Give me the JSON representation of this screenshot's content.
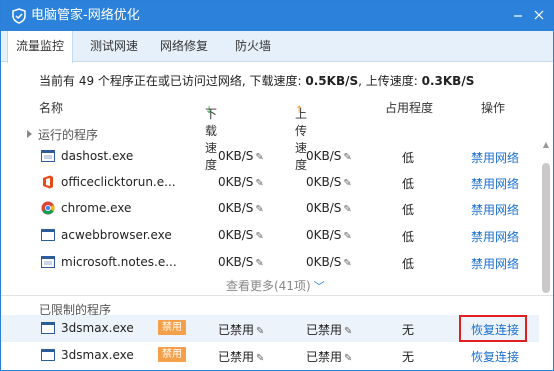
{
  "window": {
    "title": "电脑管家-网络优化"
  },
  "tabs": [
    {
      "label": "流量监控"
    },
    {
      "label": "测试网速"
    },
    {
      "label": "网络修复"
    },
    {
      "label": "防火墙"
    }
  ],
  "summary": {
    "prefix": "当前有 49 个程序正在或已访问过网络, 下载速度: ",
    "download": "0.5KB/S",
    "mid": ", 上传速度: ",
    "upload": "0.3KB/S"
  },
  "columns": {
    "name": "名称",
    "download": "下载速度",
    "upload": "上传速度",
    "occupancy": "占用程度",
    "action": "操作"
  },
  "running": {
    "label": "运行的程序",
    "rows": [
      {
        "name": "dashost.exe",
        "download": "0KB/S",
        "upload": "0KB/S",
        "occupancy": "低",
        "action": "禁用网络",
        "icon": "window-icon"
      },
      {
        "name": "officeclicktorun.e...",
        "download": "0KB/S",
        "upload": "0KB/S",
        "occupancy": "低",
        "action": "禁用网络",
        "icon": "office-icon"
      },
      {
        "name": "chrome.exe",
        "download": "0KB/S",
        "upload": "0KB/S",
        "occupancy": "低",
        "action": "禁用网络",
        "icon": "chrome-icon"
      },
      {
        "name": "acwebbrowser.exe",
        "download": "0KB/S",
        "upload": "0KB/S",
        "occupancy": "低",
        "action": "禁用网络",
        "icon": "window-icon"
      },
      {
        "name": "microsoft.notes.e...",
        "download": "0KB/S",
        "upload": "0KB/S",
        "occupancy": "低",
        "action": "禁用网络",
        "icon": "window-icon"
      }
    ],
    "more": "查看更多(41项)"
  },
  "restricted": {
    "label": "已限制的程序",
    "rows": [
      {
        "name": "3dsmax.exe",
        "badge": "禁用",
        "download": "已禁用",
        "upload": "已禁用",
        "occupancy": "无",
        "action": "恢复连接"
      },
      {
        "name": "3dsmax.exe",
        "badge": "禁用",
        "download": "已禁用",
        "upload": "已禁用",
        "occupancy": "无",
        "action": "恢复连接"
      }
    ]
  },
  "colors": {
    "titlebar": "#2c82db",
    "link": "#1a6fd0",
    "badge": "#f4a04a",
    "highlight": "#e02020"
  }
}
